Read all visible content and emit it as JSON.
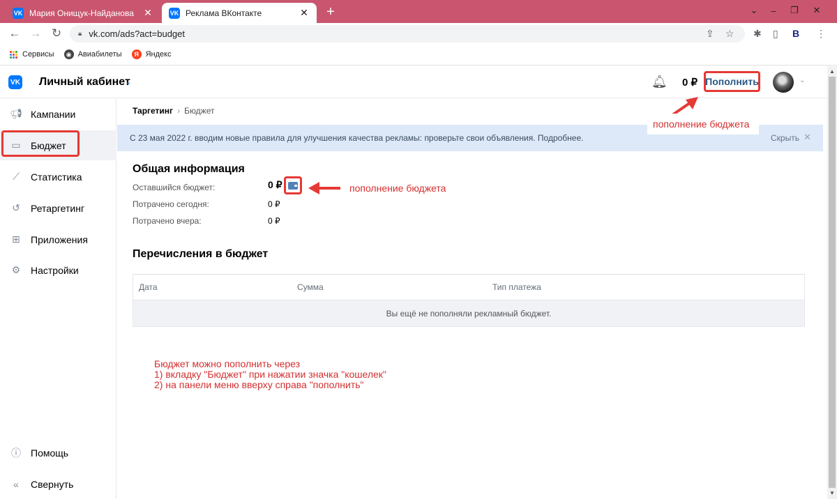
{
  "browser": {
    "tabs": [
      {
        "title": "Мария Онищук-Найданова",
        "active": false,
        "favicon": "VK"
      },
      {
        "title": "Реклама ВКонтакте",
        "active": true,
        "favicon": "VK"
      }
    ],
    "url": "vk.com/ads?act=budget",
    "bookmarks": [
      {
        "label": "Сервисы",
        "icon": "apps-grid-icon"
      },
      {
        "label": "Авиабилеты",
        "icon": "globe-icon"
      },
      {
        "label": "Яндекс",
        "icon": "yandex-icon"
      }
    ]
  },
  "header": {
    "logo": "VK",
    "title": "Личный кабинет",
    "balance": "0 ₽",
    "topup_label": "Пополнить"
  },
  "sidebar": {
    "items": [
      {
        "label": "Кампании",
        "icon": "megaphone-icon"
      },
      {
        "label": "Бюджет",
        "icon": "wallet-icon",
        "active": true
      },
      {
        "label": "Статистика",
        "icon": "chart-icon"
      },
      {
        "label": "Ретаргетинг",
        "icon": "retarget-icon"
      },
      {
        "label": "Приложения",
        "icon": "apps-icon"
      },
      {
        "label": "Настройки",
        "icon": "settings-icon"
      }
    ],
    "help_label": "Помощь",
    "collapse_label": "Свернуть"
  },
  "breadcrumb": {
    "root": "Таргетинг",
    "current": "Бюджет"
  },
  "notice": {
    "text": "С 23 мая 2022 г. вводим новые правила для улучшения качества рекламы: проверьте свои объявления. Подробнее.",
    "hide_label": "Скрыть"
  },
  "general": {
    "title": "Общая информация",
    "remaining_label": "Оставшийся бюджет:",
    "remaining_value": "0 ₽",
    "today_label": "Потрачено сегодня:",
    "today_value": "0 ₽",
    "yesterday_label": "Потрачено вчера:",
    "yesterday_value": "0 ₽"
  },
  "transfers": {
    "title": "Перечисления в бюджет",
    "columns": [
      "Дата",
      "Сумма",
      "Тип платежа"
    ],
    "empty_text": "Вы ещё не пополняли рекламный бюджет."
  },
  "annotations": {
    "top_note": "пополнение бюджета",
    "wallet_note": "пополнение бюджета",
    "instructions": [
      "Бюджет можно пополнить через",
      "1) вкладку \"Бюджет\" при нажатии значка \"кошелек\"",
      "2) на панели меню вверху справа \"пополнить\""
    ],
    "color": "#d32f2f"
  }
}
